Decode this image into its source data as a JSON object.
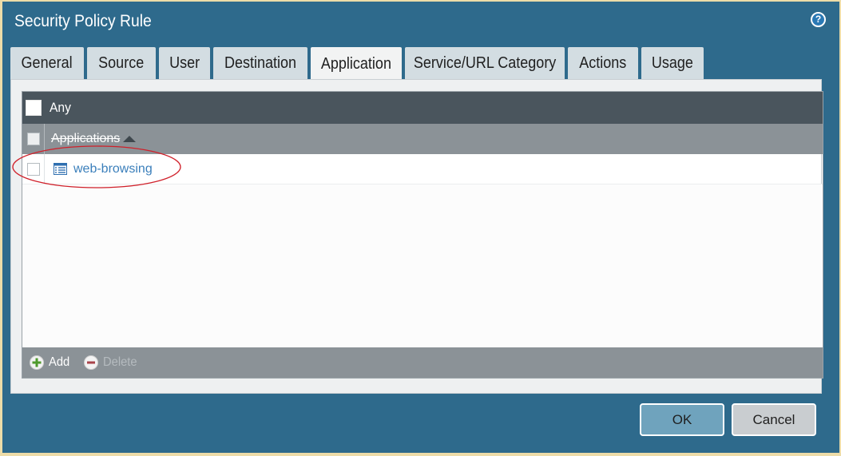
{
  "window": {
    "title": "Security Policy Rule",
    "help_icon": "help-icon"
  },
  "tabs": [
    {
      "label": "General",
      "active": false
    },
    {
      "label": "Source",
      "active": false
    },
    {
      "label": "User",
      "active": false
    },
    {
      "label": "Destination",
      "active": false
    },
    {
      "label": "Application",
      "active": true
    },
    {
      "label": "Service/URL Category",
      "active": false
    },
    {
      "label": "Actions",
      "active": false
    },
    {
      "label": "Usage",
      "active": false
    }
  ],
  "application_panel": {
    "any_label": "Any",
    "any_checked": false,
    "column_header": "Applications",
    "sort_icon": "sort-ascending-icon",
    "rows": [
      {
        "name": "web-browsing",
        "icon": "application-icon",
        "checked": false
      }
    ],
    "footer": {
      "add_label": "Add",
      "add_icon": "plus-icon",
      "delete_label": "Delete",
      "delete_icon": "minus-icon"
    }
  },
  "buttons": {
    "ok_label": "OK",
    "cancel_label": "Cancel"
  },
  "colors": {
    "dialog_background": "#2e6a8c",
    "link": "#3b7fbb",
    "highlight_annotation": "#d0202a"
  }
}
